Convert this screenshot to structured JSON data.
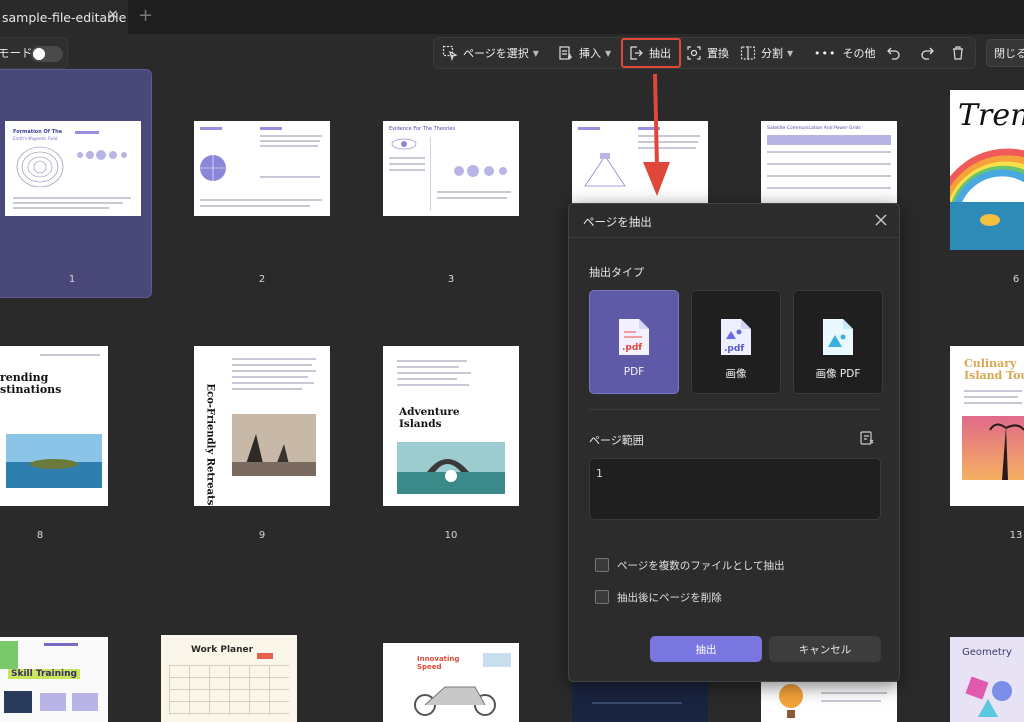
{
  "tab": {
    "title": "sample-file-editable",
    "close": "✕",
    "add": "+"
  },
  "mode": {
    "label": "モード"
  },
  "toolbar": {
    "select_pages": "ページを選択",
    "insert": "挿入",
    "extract": "抽出",
    "replace": "置換",
    "split": "分割",
    "more": "その他",
    "close": "閉じる"
  },
  "pages": {
    "p1": "1",
    "p2": "2",
    "p3": "3",
    "p6": "6",
    "p8": "8",
    "p9": "9",
    "p10": "10",
    "p13": "13"
  },
  "thumbs": {
    "t1_title": "Formation Of The",
    "t1_sub": "Earth's Magnetic Field",
    "t3_title": "Evidence For The Theories",
    "t5_title": "Satellite Communication And Power Grids",
    "t6_title": "Trend",
    "t8_title": "rending\nstinations",
    "t9_title": "Eco-Friendly Retreats",
    "t10_title": "Adventure\nIslands",
    "t13_title": "Culinary\nIsland Tour",
    "t_skill": "Skill Training",
    "t_work": "Work Planer",
    "t_speed": "Innovating\nSpeed",
    "t_geometry": "Geometry"
  },
  "dialog": {
    "title": "ページを抽出",
    "type_label": "抽出タイプ",
    "types": [
      {
        "label": "PDF",
        "badge": ".pdf"
      },
      {
        "label": "画像",
        "badge": ".pdf"
      },
      {
        "label": "画像 PDF",
        "badge": ""
      }
    ],
    "range_label": "ページ範囲",
    "range_value": "1",
    "option_multi": "ページを複数のファイルとして抽出",
    "option_delete": "抽出後にページを削除",
    "extract_button": "抽出",
    "cancel_button": "キャンセル"
  },
  "colors": {
    "accent": "#7a76e0",
    "selected": "#4a4878",
    "highlight": "#e0473b"
  }
}
